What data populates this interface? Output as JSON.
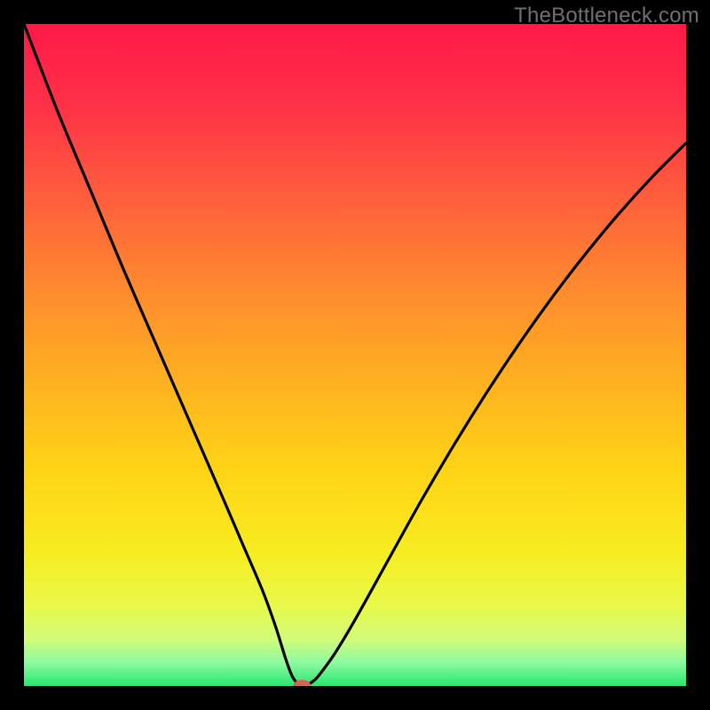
{
  "watermark": "TheBottleneck.com",
  "chart_data": {
    "type": "line",
    "title": "",
    "xlabel": "",
    "ylabel": "",
    "xlim": [
      0,
      100
    ],
    "ylim": [
      0,
      100
    ],
    "x": [
      0,
      5,
      10,
      15,
      20,
      25,
      30,
      33,
      36,
      38,
      39.5,
      40.5,
      41.5,
      42,
      43,
      44,
      45,
      47,
      50,
      55,
      60,
      65,
      70,
      75,
      80,
      85,
      90,
      95,
      100
    ],
    "y": [
      100,
      87,
      75,
      63,
      51.5,
      40,
      28.5,
      21.5,
      14.5,
      9,
      4.2,
      1.5,
      0.2,
      0,
      0.3,
      1,
      2.2,
      5,
      10,
      19,
      28,
      36.5,
      44.5,
      52,
      59,
      65.5,
      71.5,
      77,
      82
    ],
    "marker": {
      "x": 42,
      "y": 0
    },
    "gradient_stops": [
      {
        "pos": 0.0,
        "color": "#ff1947"
      },
      {
        "pos": 0.12,
        "color": "#ff3047"
      },
      {
        "pos": 0.25,
        "color": "#ff5a3e"
      },
      {
        "pos": 0.4,
        "color": "#ff8a2f"
      },
      {
        "pos": 0.55,
        "color": "#ffb41f"
      },
      {
        "pos": 0.68,
        "color": "#ffd516"
      },
      {
        "pos": 0.8,
        "color": "#f7ed21"
      },
      {
        "pos": 0.88,
        "color": "#e9f84a"
      },
      {
        "pos": 0.93,
        "color": "#d1fb7a"
      },
      {
        "pos": 0.965,
        "color": "#8ef9a0"
      },
      {
        "pos": 1.0,
        "color": "#28e76f"
      }
    ]
  }
}
